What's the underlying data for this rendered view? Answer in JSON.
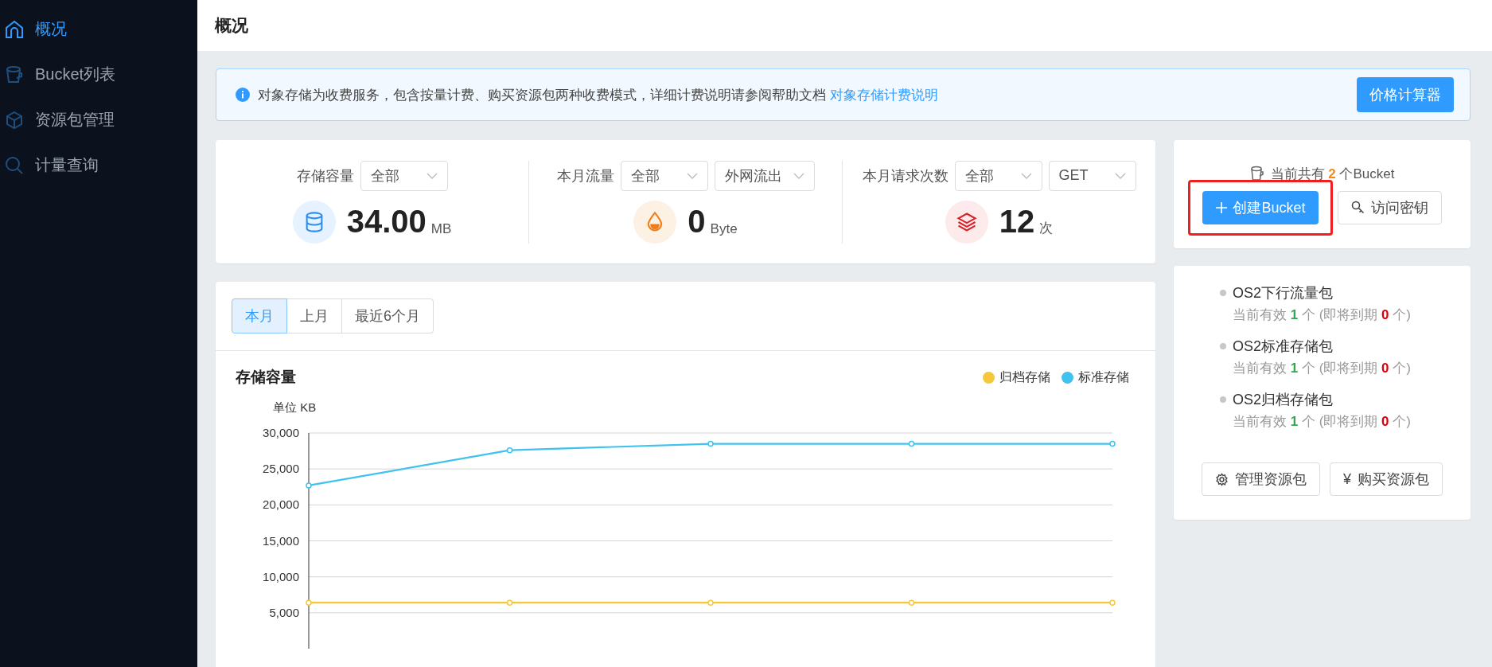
{
  "sidebar": {
    "items": [
      {
        "label": "概况",
        "kind": "home",
        "selected": true
      },
      {
        "label": "Bucket列表",
        "kind": "bucket",
        "selected": false
      },
      {
        "label": "资源包管理",
        "kind": "cube",
        "selected": false
      },
      {
        "label": "计量查询",
        "kind": "search",
        "selected": false
      }
    ]
  },
  "header": {
    "title": "概况"
  },
  "notice": {
    "text": "对象存储为收费服务，包含按量计费、购买资源包两种收费模式，详细计费说明请参阅帮助文档",
    "link": "对象存储计费说明",
    "button": "价格计算器"
  },
  "stats": [
    {
      "label": "存储容量",
      "selects": [
        "全部"
      ],
      "kind": "database",
      "value": "34.00",
      "unit": "MB"
    },
    {
      "label": "本月流量",
      "selects": [
        "全部",
        "外网流出"
      ],
      "kind": "drop",
      "value": "0",
      "unit": "Byte"
    },
    {
      "label": "本月请求次数",
      "selects": [
        "全部",
        "GET"
      ],
      "kind": "layers",
      "value": "12",
      "unit": "次"
    }
  ],
  "period_tabs": [
    {
      "label": "本月",
      "selected": true
    },
    {
      "label": "上月",
      "selected": false
    },
    {
      "label": "最近6个月",
      "selected": false
    }
  ],
  "chart": {
    "title": "存储容量",
    "unit_label": "单位 KB",
    "chart_data": {
      "type": "line",
      "grid": true,
      "ylim": [
        0,
        30000
      ],
      "yticks": [
        {
          "value": 5000,
          "label": "5,000"
        },
        {
          "value": 10000,
          "label": "10,000"
        },
        {
          "value": 15000,
          "label": "15,000"
        },
        {
          "value": 20000,
          "label": "20,000"
        },
        {
          "value": 25000,
          "label": "25,000"
        },
        {
          "value": 30000,
          "label": "30,000"
        }
      ],
      "series": [
        {
          "name": "归档存储",
          "color": "#f5c83b",
          "marker": true,
          "values": [
            6400,
            6400,
            6400,
            6400,
            6400
          ]
        },
        {
          "name": "标准存储",
          "color": "#40c2ef",
          "marker": true,
          "values": [
            22700,
            27600,
            28500,
            28500,
            28500
          ]
        }
      ]
    }
  },
  "bucket_summary": {
    "prefix": "当前共有",
    "count": "2",
    "suffix": "个Bucket",
    "create_button": {
      "label": "创建Bucket",
      "highlighted": true
    },
    "key_button": "访问密钥"
  },
  "packages": [
    {
      "name": "OS2下行流量包",
      "prefix": "当前有效",
      "active": "1",
      "middle": "个 (即将到期",
      "expiring": "0",
      "suffix": "个)"
    },
    {
      "name": "OS2标准存储包",
      "prefix": "当前有效",
      "active": "1",
      "middle": "个 (即将到期",
      "expiring": "0",
      "suffix": "个)"
    },
    {
      "name": "OS2归档存储包",
      "prefix": "当前有效",
      "active": "1",
      "middle": "个 (即将到期",
      "expiring": "0",
      "suffix": "个)"
    }
  ],
  "package_buttons": [
    {
      "kind": "gear",
      "label": "管理资源包"
    },
    {
      "kind": "text",
      "symbol": "¥",
      "label": "购买资源包"
    }
  ]
}
